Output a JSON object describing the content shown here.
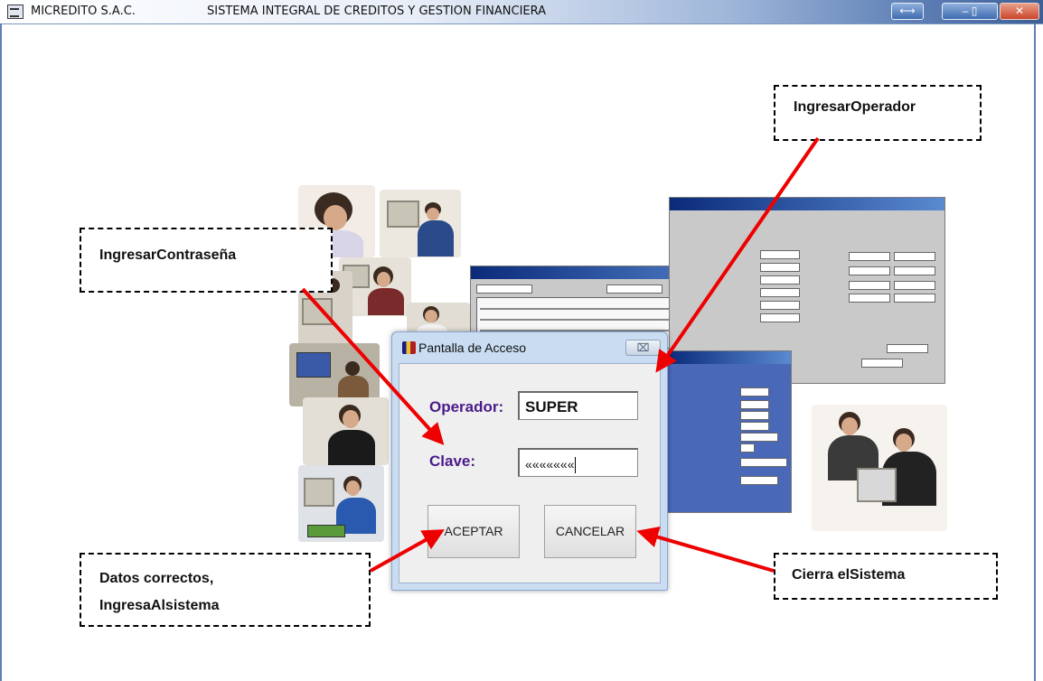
{
  "window": {
    "app_name": "MICREDITO S.A.C.",
    "system_name": "SISTEMA INTEGRAL DE CREDITOS Y GESTION FINANCIERA",
    "resize_glyph": "⟷",
    "group_glyph": "– ▯",
    "close_glyph": "✕"
  },
  "dialog": {
    "title": "Pantalla de Acceso",
    "close_glyph": "⌧",
    "operador_label": "Operador:",
    "operador_value": "SUPER",
    "clave_label": "Clave:",
    "clave_value": "«««««««",
    "aceptar_label": "ACEPTAR",
    "cancelar_label": "CANCELAR"
  },
  "annotations": {
    "ingresar_operador": "IngresarOperador",
    "ingresar_contrasena": "IngresarContraseña",
    "datos_correctos_line1": "Datos correctos,",
    "datos_correctos_line2": "IngresaAlsistema",
    "cierra_sistema": "Cierra elSistema"
  },
  "colors": {
    "arrow": "#ee0000",
    "label_purple": "#4a1a8a",
    "title_bar_blue": "#3d5f96"
  }
}
